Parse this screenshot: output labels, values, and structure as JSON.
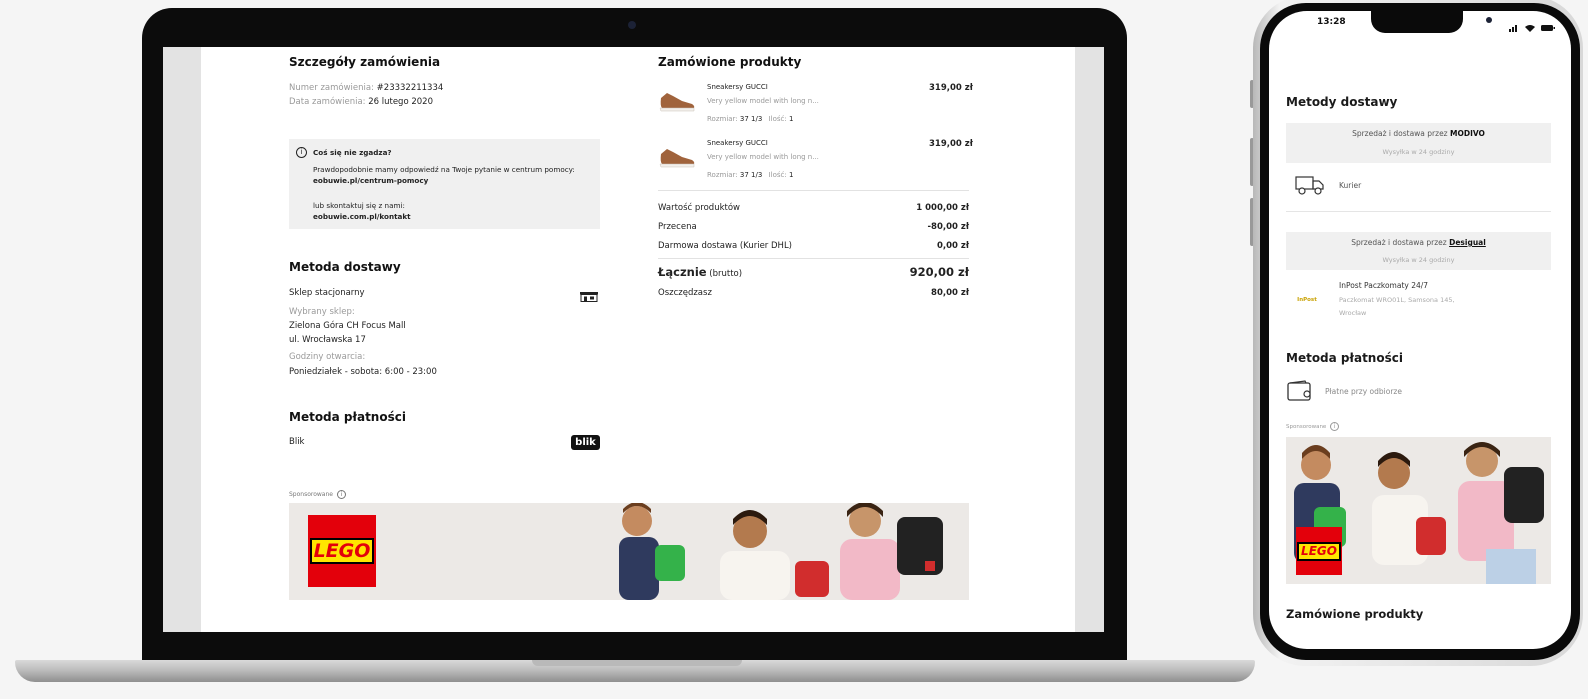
{
  "laptop": {
    "order_details": {
      "title": "Szczegóły zamówienia",
      "order_number_label": "Numer zamówienia:",
      "order_number": "#23332211334",
      "order_date_label": "Data zamówienia:",
      "order_date": "26 lutego 2020"
    },
    "help_box": {
      "title": "Coś się nie zgadza?",
      "line1": "Prawdopodobnie mamy odpowiedź na Twoje pytanie w centrum pomocy:",
      "help_link": "eobuwie.pl/centrum-pomocy",
      "line2": "lub skontaktuj się z nami:",
      "contact_link": "eobuwie.com.pl/kontakt"
    },
    "delivery": {
      "title": "Metoda dostawy",
      "method": "Sklep stacjonarny",
      "selected_store_label": "Wybrany sklep:",
      "store_name": "Zielona Góra CH Focus Mall",
      "store_address": "ul. Wrocławska 17",
      "hours_label": "Godziny otwarcia:",
      "hours": "Poniedziałek - sobota: 6:00 - 23:00"
    },
    "payment": {
      "title": "Metoda płatności",
      "method": "Blik",
      "logo_text": "blik"
    },
    "products": {
      "title": "Zamówione produkty",
      "items": [
        {
          "name": "Sneakersy GUCCI",
          "desc": "Very yellow model with long n...",
          "size_label": "Rozmiar:",
          "size": "37 1/3",
          "qty_label": "Ilość:",
          "qty": "1",
          "price": "319,00 zł"
        },
        {
          "name": "Sneakersy GUCCI",
          "desc": "Very yellow model with long n...",
          "size_label": "Rozmiar:",
          "size": "37 1/3",
          "qty_label": "Ilość:",
          "qty": "1",
          "price": "319,00 zł"
        }
      ]
    },
    "summary": {
      "products_value_label": "Wartość produktów",
      "products_value": "1 000,00 zł",
      "discount_label": "Przecena",
      "discount": "-80,00 zł",
      "shipping_label": "Darmowa dostawa (Kurier DHL)",
      "shipping": "0,00 zł",
      "total_label": "Łącznie",
      "total_suffix": "(brutto)",
      "total": "920,00 zł",
      "savings_label": "Oszczędzasz",
      "savings": "80,00 zł"
    },
    "ad": {
      "sponsored_label": "Sponsorowane",
      "brand": "LEGO"
    }
  },
  "phone": {
    "status_time": "13:28",
    "delivery_title": "Metody dostawy",
    "seller1_prefix": "Sprzedaż i dostawa przez",
    "seller1_name": "MODIVO",
    "seller1_ship": "Wysyłka w 24 godziny",
    "courier_label": "Kurier",
    "seller2_prefix": "Sprzedaż i dostawa przez",
    "seller2_name": "Desigual",
    "seller2_ship": "Wysyłka w 24 godziny",
    "inpost_logo": "InPost",
    "inpost_title": "InPost Paczkomaty 24/7",
    "inpost_address1": "Paczkomat WRO01L, Samsona 145,",
    "inpost_address2": "Wrocław",
    "payment_title": "Metoda płatności",
    "payment_method": "Płatne przy odbiorze",
    "sponsored_label": "Sponsorowane",
    "ad_brand": "LEGO",
    "products_title": "Zamówione produkty"
  },
  "colors": {
    "discount_red": "#d0021b",
    "free_green": "#2eaa33",
    "lego_red": "#e3000b",
    "lego_yellow": "#ffe500"
  },
  "icons": [
    "info-icon",
    "store-icon",
    "blik-logo",
    "truck-icon",
    "inpost-logo",
    "wallet-icon",
    "shoe-image"
  ]
}
